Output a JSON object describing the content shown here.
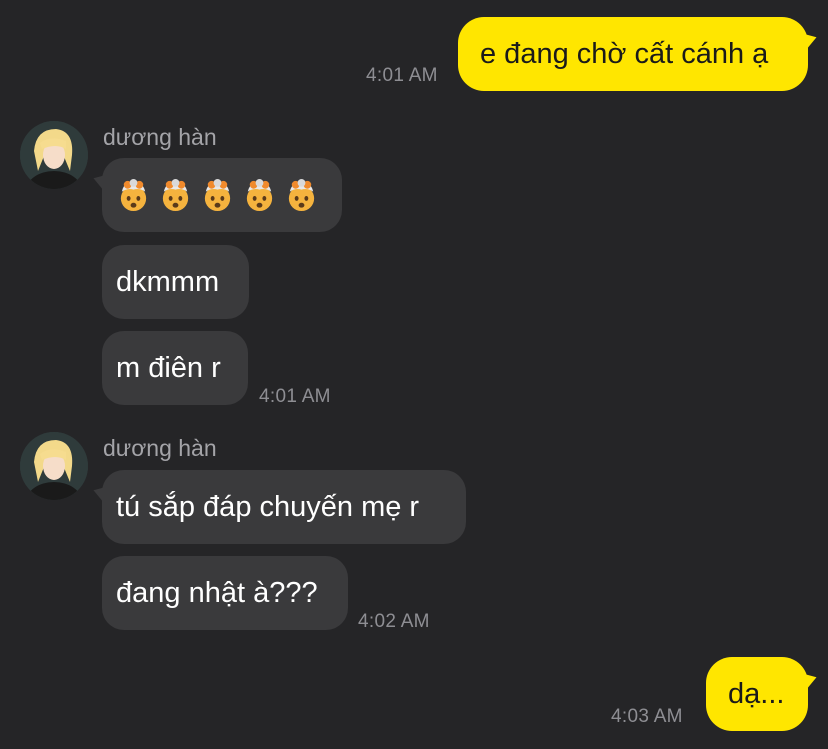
{
  "messages": {
    "m1": {
      "text": "e đang chờ cất cánh ạ",
      "time": "4:01 AM"
    },
    "g1": {
      "sender": "dương hàn",
      "emoji": [
        "exploding-head",
        "exploding-head",
        "exploding-head",
        "exploding-head",
        "exploding-head"
      ],
      "text2": "dkmmm",
      "text3": "m điên r",
      "time": "4:01 AM"
    },
    "g2": {
      "sender": "dương hàn",
      "text1": "tú sắp đáp chuyến mẹ r",
      "text2": "đang nhật à???",
      "time": "4:02 AM"
    },
    "m2": {
      "text": "dạ...",
      "time": "4:03 AM"
    }
  },
  "colors": {
    "background": "#252527",
    "my_bubble": "#ffe600",
    "their_bubble": "#3a3a3c",
    "timestamp": "#8e8e93"
  }
}
